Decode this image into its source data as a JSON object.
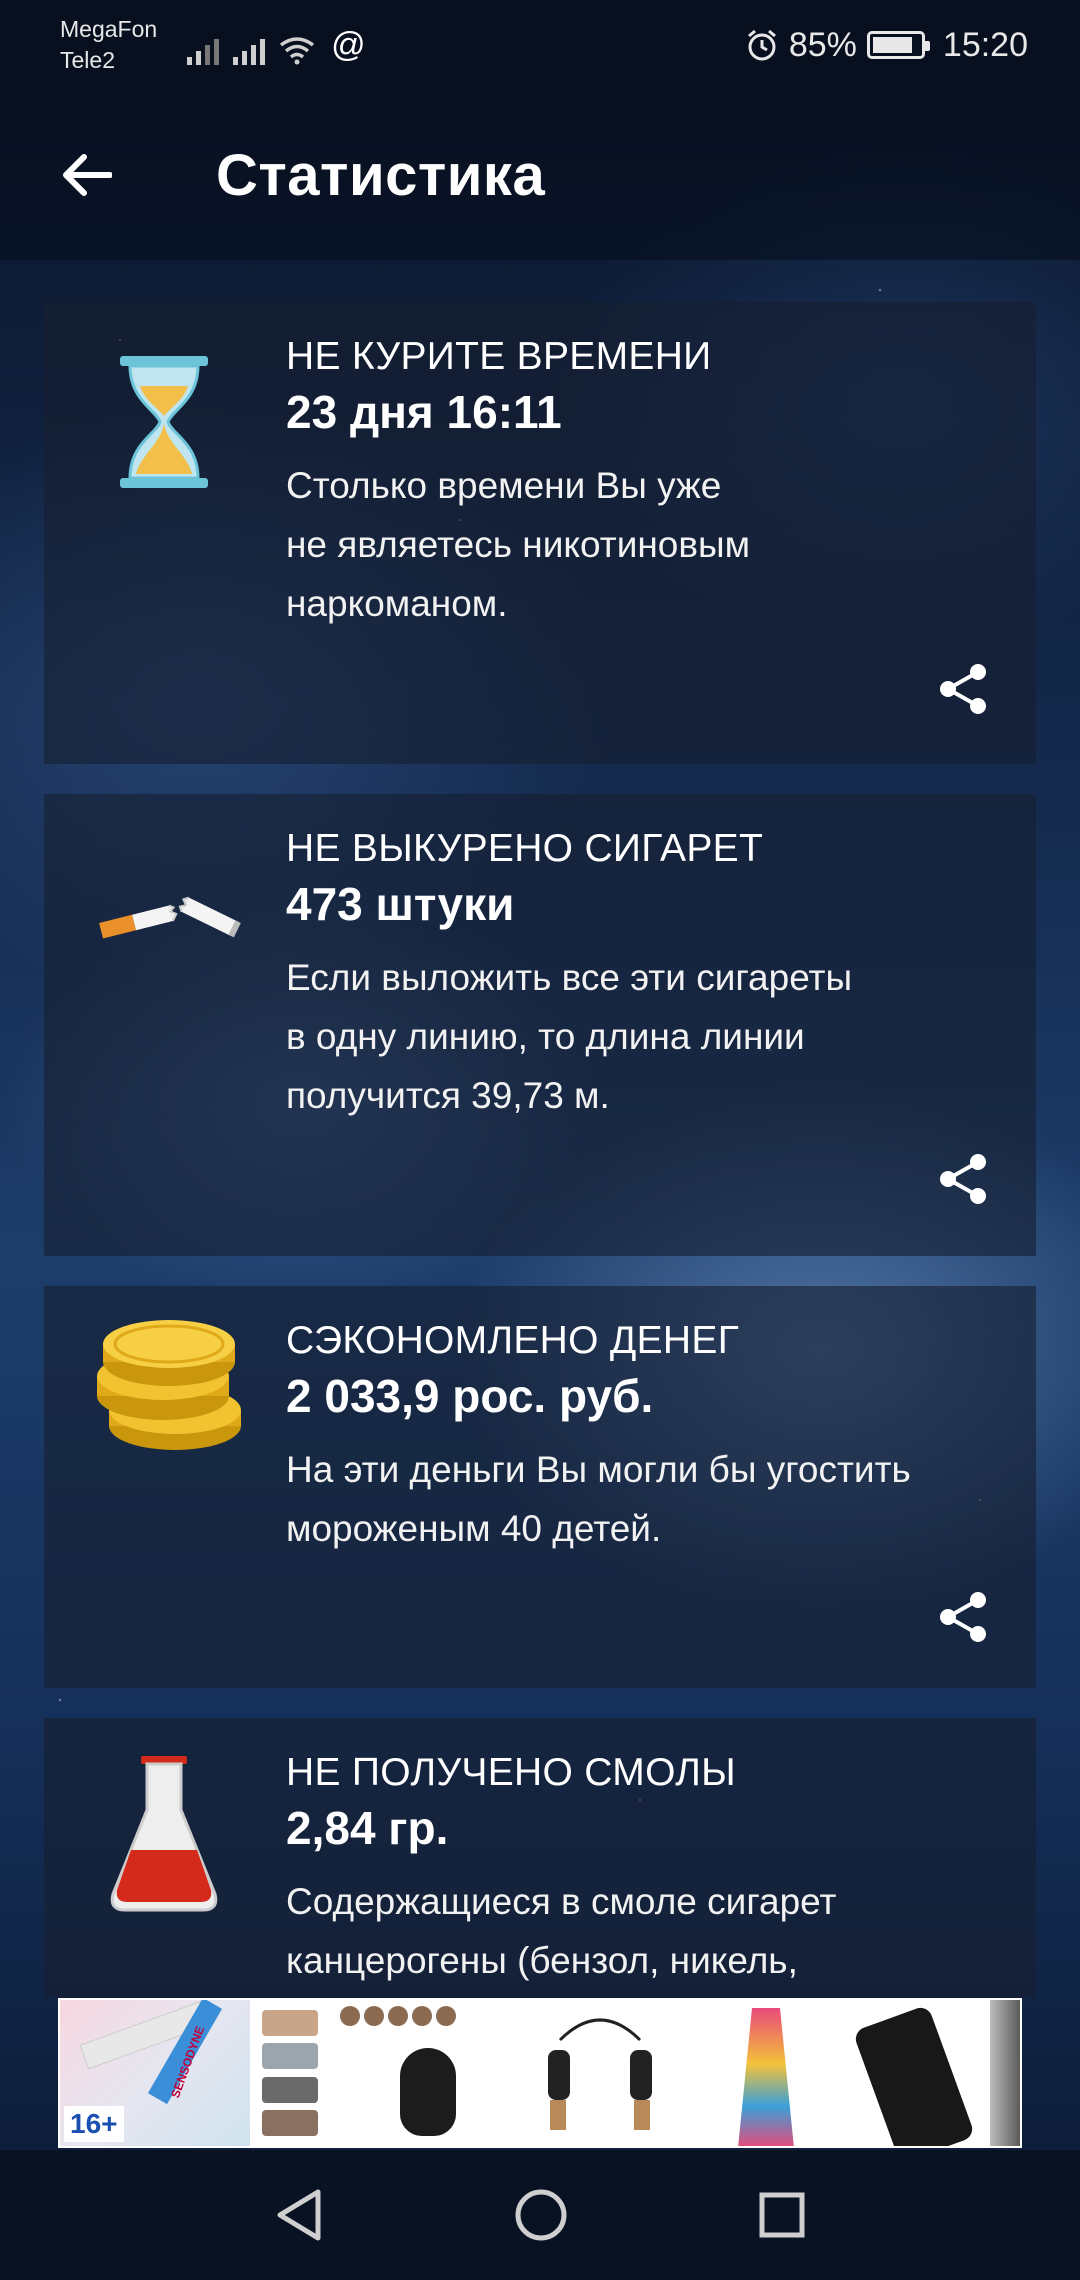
{
  "status_bar": {
    "carrier_1": "MegaFon",
    "carrier_2": "Tele2",
    "battery": "85%",
    "time": "15:20",
    "icons": [
      "signal-icon",
      "signal-icon",
      "wifi-icon",
      "at-icon",
      "alarm-icon",
      "battery-icon"
    ]
  },
  "app_bar": {
    "title": "Статистика",
    "back_icon": "arrow-left-icon"
  },
  "cards": [
    {
      "icon": "hourglass-icon",
      "heading": "НЕ КУРИТЕ ВРЕМЕНИ",
      "value": "23 дня 16:11",
      "description_lines": [
        "Столько времени Вы уже",
        "не являетесь никотиновым",
        "наркоманом."
      ]
    },
    {
      "icon": "broken-cigarette-icon",
      "heading": "НЕ ВЫКУРЕНО СИГАРЕТ",
      "value": "473 штуки",
      "description_lines": [
        "Если выложить все эти сигареты",
        "в одну линию, то длина линии",
        "получится 39,73 м."
      ]
    },
    {
      "icon": "coins-icon",
      "heading": "СЭКОНОМЛЕНО ДЕНЕГ",
      "value": "2 033,9 рос. руб.",
      "description_lines": [
        "На эти деньги Вы могли бы угостить",
        "мороженым 40 детей."
      ]
    },
    {
      "icon": "flask-icon",
      "heading": "НЕ ПОЛУЧЕНО СМОЛЫ",
      "value": "2,84 гр.",
      "description_lines": [
        "Содержащиеся в смоле сигарет",
        "канцерогены (бензол, никель,"
      ]
    }
  ],
  "ad": {
    "age_rating": "16+",
    "brand": "SENSODYNE"
  },
  "nav_bar": {
    "icons": [
      "back-triangle-icon",
      "home-circle-icon",
      "recents-square-icon"
    ]
  },
  "colors": {
    "card_bg": "#161e30",
    "coin": "#f2c230",
    "flask_liquid": "#d42a1c",
    "hourglass_frame": "#6cc4d8",
    "sand": "#f2c04a"
  }
}
